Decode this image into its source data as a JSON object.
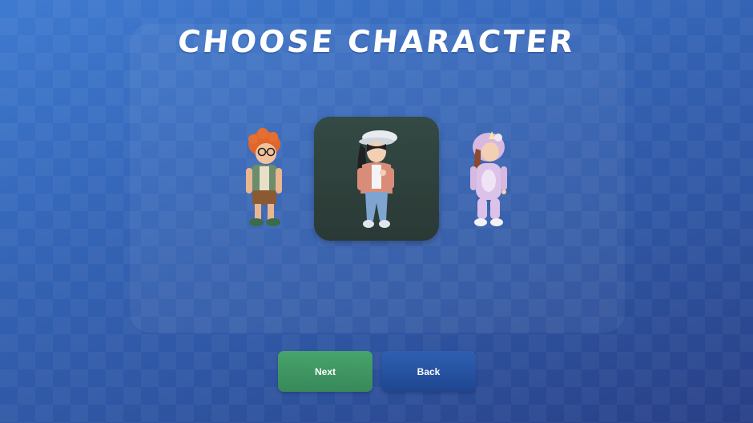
{
  "screen": {
    "title": "CHOOSE CHARACTER"
  },
  "characters": [
    {
      "name": "boy-with-glasses",
      "selected": false
    },
    {
      "name": "girl-with-cap",
      "selected": true
    },
    {
      "name": "girl-unicorn-costume",
      "selected": false
    }
  ],
  "buttons": {
    "next_label": "Next",
    "back_label": "Back"
  },
  "colors": {
    "next_button": "#3f9664",
    "back_button": "#2753a1",
    "selected_frame": "#2f413c"
  }
}
